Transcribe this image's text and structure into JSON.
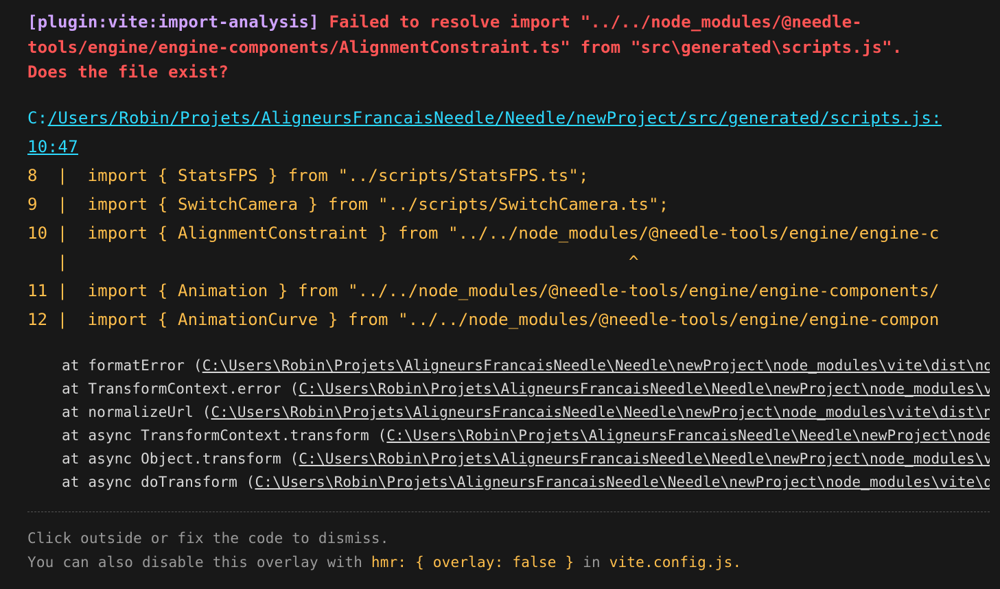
{
  "error": {
    "plugin": "[plugin:vite:import-analysis]",
    "message_line1": "Failed to resolve import \"../../node_modules/@needle-",
    "message_line2": "tools/engine/engine-components/AlignmentConstraint.ts\" from \"src\\generated\\scripts.js\".",
    "message_line3": "Does the file exist?"
  },
  "file": {
    "prefix": "C:",
    "link": "/Users/Robin/Projets/AligneursFrancaisNeedle/Needle/newProject/src/generated/scripts.js:",
    "position": "10:47"
  },
  "code_frame": [
    "8  |  import { StatsFPS } from \"../scripts/StatsFPS.ts\";",
    "9  |  import { SwitchCamera } from \"../scripts/SwitchCamera.ts\";",
    "10 |  import { AlignmentConstraint } from \"../../node_modules/@needle-tools/engine/engine-c",
    "   |                                                        ^",
    "11 |  import { Animation } from \"../../node_modules/@needle-tools/engine/engine-components/",
    "12 |  import { AnimationCurve } from \"../../node_modules/@needle-tools/engine/engine-compon"
  ],
  "stack": [
    {
      "prefix": "at formatError (",
      "path": "C:\\Users\\Robin\\Projets\\AligneursFrancaisNeedle\\Needle\\newProject\\node_modules\\vite\\dist\\node"
    },
    {
      "prefix": "at TransformContext.error (",
      "path": "C:\\Users\\Robin\\Projets\\AligneursFrancaisNeedle\\Needle\\newProject\\node_modules\\vit"
    },
    {
      "prefix": "at normalizeUrl (",
      "path": "C:\\Users\\Robin\\Projets\\AligneursFrancaisNeedle\\Needle\\newProject\\node_modules\\vite\\dist\\nod"
    },
    {
      "prefix": "at async TransformContext.transform (",
      "path": "C:\\Users\\Robin\\Projets\\AligneursFrancaisNeedle\\Needle\\newProject\\node_m"
    },
    {
      "prefix": "at async Object.transform (",
      "path": "C:\\Users\\Robin\\Projets\\AligneursFrancaisNeedle\\Needle\\newProject\\node_modules\\vit"
    },
    {
      "prefix": "at async doTransform (",
      "path": "C:\\Users\\Robin\\Projets\\AligneursFrancaisNeedle\\Needle\\newProject\\node_modules\\vite\\dis"
    }
  ],
  "tip": {
    "line1": "Click outside or fix the code to dismiss.",
    "line2_prefix": "You can also disable this overlay with ",
    "line2_code1": "hmr: { overlay: false }",
    "line2_mid": " in ",
    "line2_code2": "vite.config.js."
  },
  "colors": {
    "background": "#181818",
    "plugin": "#cfa3ff",
    "error": "#ff5555",
    "file": "#2dd9fe",
    "frame": "#ffbf4c",
    "tip": "#9a9a9a"
  }
}
